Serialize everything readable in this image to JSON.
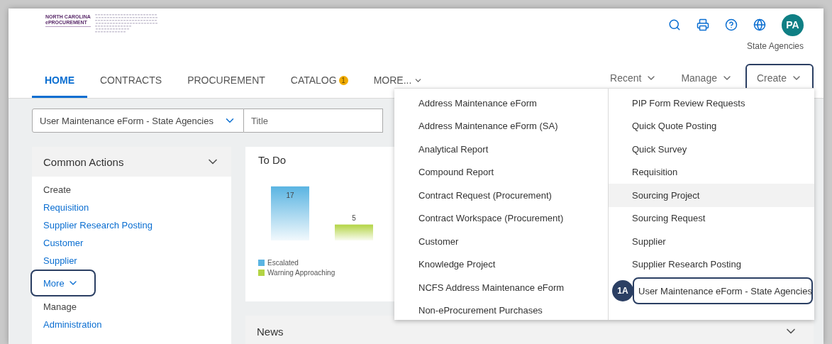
{
  "logo": {
    "line1": "NORTH CAROLINA",
    "line2": "ePROCUREMENT"
  },
  "header": {
    "avatar": "PA",
    "account": "State Agencies"
  },
  "tabs": [
    {
      "label": "HOME",
      "selected": true
    },
    {
      "label": "CONTRACTS",
      "selected": false
    },
    {
      "label": "PROCUREMENT",
      "selected": false
    },
    {
      "label": "CATALOG",
      "selected": false,
      "badge": "1"
    },
    {
      "label": "MORE...",
      "selected": false,
      "dropdown": true
    }
  ],
  "menus": [
    {
      "label": "Recent",
      "highlighted": false
    },
    {
      "label": "Manage",
      "highlighted": false
    },
    {
      "label": "Create",
      "highlighted": true
    }
  ],
  "search": {
    "scope": "User Maintenance eForm - State Agencies",
    "placeholder": "Title"
  },
  "common_actions": {
    "title": "Common Actions",
    "items": [
      {
        "kind": "heading",
        "text": "Create"
      },
      {
        "kind": "link",
        "text": "Requisition"
      },
      {
        "kind": "link",
        "text": "Supplier Research Posting"
      },
      {
        "kind": "link",
        "text": "Customer"
      },
      {
        "kind": "link",
        "text": "Supplier"
      },
      {
        "kind": "more",
        "text": "More",
        "highlighted": true
      },
      {
        "kind": "heading",
        "text": "Manage"
      },
      {
        "kind": "link",
        "text": "Administration"
      }
    ]
  },
  "todo": {
    "title": "To Do",
    "items": [
      {
        "label": "Escalated",
        "count": "17",
        "color": "#5ab4e2"
      },
      {
        "label": "Warning Approaching",
        "count": "5",
        "color": "#b3d444"
      }
    ]
  },
  "news": {
    "title": "News"
  },
  "create_menu": {
    "columns": [
      [
        {
          "text": "Address Maintenance eForm",
          "hovered": false
        },
        {
          "text": "Address Maintenance eForm (SA)",
          "hovered": false
        },
        {
          "text": "Analytical Report",
          "hovered": false
        },
        {
          "text": "Compound Report",
          "hovered": false
        },
        {
          "text": "Contract Request (Procurement)",
          "hovered": false
        },
        {
          "text": "Contract Workspace (Procurement)",
          "hovered": false
        },
        {
          "text": "Customer",
          "hovered": false
        },
        {
          "text": "Knowledge Project",
          "hovered": false
        },
        {
          "text": "NCFS Address Maintenance eForm",
          "hovered": false
        },
        {
          "text": "Non-eProcurement Purchases",
          "hovered": false
        }
      ],
      [
        {
          "text": "PIP Form Review Requests",
          "hovered": false
        },
        {
          "text": "Quick Quote Posting",
          "hovered": false
        },
        {
          "text": "Quick Survey",
          "hovered": false
        },
        {
          "text": "Requisition",
          "hovered": false
        },
        {
          "text": "Sourcing Project",
          "hovered": true
        },
        {
          "text": "Sourcing Request",
          "hovered": false
        },
        {
          "text": "Supplier",
          "hovered": false
        },
        {
          "text": "Supplier Research Posting",
          "hovered": false
        },
        {
          "text": "User Maintenance eForm - State Agencies",
          "hovered": false,
          "highlighted": true,
          "callout": "1A"
        }
      ]
    ]
  }
}
